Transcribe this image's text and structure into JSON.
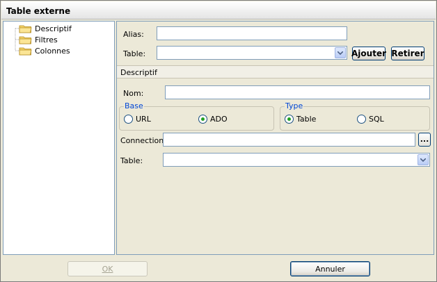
{
  "window": {
    "title": "Table externe"
  },
  "tree": {
    "items": [
      {
        "label": "Descriptif"
      },
      {
        "label": "Filtres"
      },
      {
        "label": "Colonnes"
      }
    ]
  },
  "header_fields": {
    "alias_label": "Alias:",
    "alias_value": "",
    "table_label": "Table:",
    "table_value": "",
    "add_label": "Ajouter",
    "remove_label": "Retirer"
  },
  "section": {
    "title": "Descriptif"
  },
  "form": {
    "nom_label": "Nom:",
    "nom_value": "",
    "base_group": {
      "title": "Base",
      "options": [
        {
          "label": "URL",
          "selected": false
        },
        {
          "label": "ADO",
          "selected": true
        }
      ]
    },
    "type_group": {
      "title": "Type",
      "options": [
        {
          "label": "Table",
          "selected": true
        },
        {
          "label": "SQL",
          "selected": false
        }
      ]
    },
    "connection_label": "Connection:",
    "connection_value": "",
    "browse_label": "...",
    "table_label": "Table:",
    "table_value": ""
  },
  "buttons": {
    "ok_label": "OK",
    "cancel_label": "Annuler"
  },
  "colors": {
    "accent": "#0046D5",
    "border": "#7F9DB9",
    "radio_selected": "#21A121"
  }
}
